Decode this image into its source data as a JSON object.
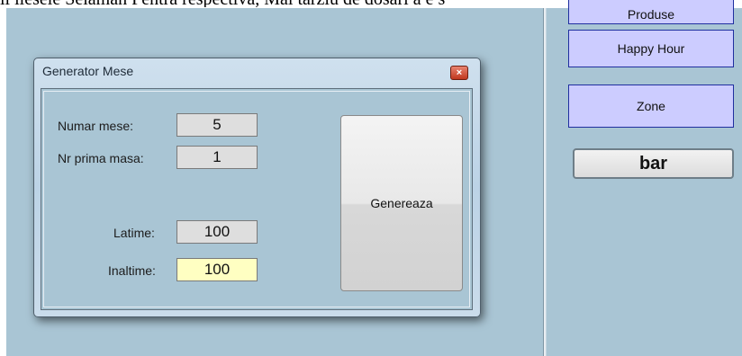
{
  "background_text": "ii ilesele Selaman Pentra respectiva, Mai tarziu de dosari a e s",
  "dialog": {
    "title": "Generator Mese",
    "close_symbol": "×",
    "fields": {
      "numar_mese": {
        "label": "Numar mese:",
        "value": "5"
      },
      "nr_prima_masa": {
        "label": "Nr prima masa:",
        "value": "1"
      },
      "latime": {
        "label": "Latime:",
        "value": "100"
      },
      "inaltime": {
        "label": "Inaltime:",
        "value": "100"
      }
    },
    "generate_label": "Genereaza"
  },
  "right_panel": {
    "buttons": [
      "Produse",
      "Happy Hour",
      "Zone"
    ],
    "bar_label": "bar"
  },
  "colors": {
    "workspace": "#a9c5d4",
    "panel_button": "#ccccff",
    "active_field": "#ffffc2"
  }
}
